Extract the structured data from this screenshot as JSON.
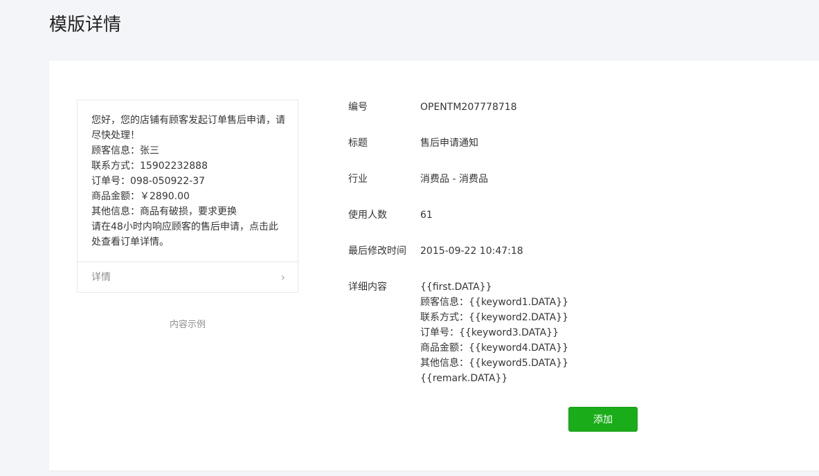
{
  "page": {
    "title": "模版详情"
  },
  "preview": {
    "lines": [
      "您好，您的店铺有顾客发起订单售后申请，请",
      "尽快处理！",
      "顾客信息：张三",
      "联系方式：15902232888",
      "订单号：098-050922-37",
      "商品金额：￥2890.00",
      "其他信息：商品有破损，要求更换",
      "请在48小时内响应顾客的售后申请，点击此",
      "处查看订单详情。"
    ],
    "detail_label": "详情",
    "chevron": "›",
    "caption": "内容示例"
  },
  "info": {
    "rows": [
      {
        "label": "编号",
        "value": "OPENTM207778718"
      },
      {
        "label": "标题",
        "value": "售后申请通知"
      },
      {
        "label": "行业",
        "value": "消费品 - 消费品"
      },
      {
        "label": "使用人数",
        "value": "61"
      },
      {
        "label": "最后修改时间",
        "value": "2015-09-22 10:47:18"
      }
    ],
    "content_label": "详细内容",
    "content_lines": [
      "{{first.DATA}}",
      "顾客信息：{{keyword1.DATA}}",
      "联系方式：{{keyword2.DATA}}",
      "订单号：{{keyword3.DATA}}",
      "商品金额：{{keyword4.DATA}}",
      "其他信息：{{keyword5.DATA}}",
      "{{remark.DATA}}"
    ]
  },
  "actions": {
    "add_label": "添加"
  },
  "colors": {
    "primary_button": "#1aad19",
    "background": "#f4f5f9"
  }
}
